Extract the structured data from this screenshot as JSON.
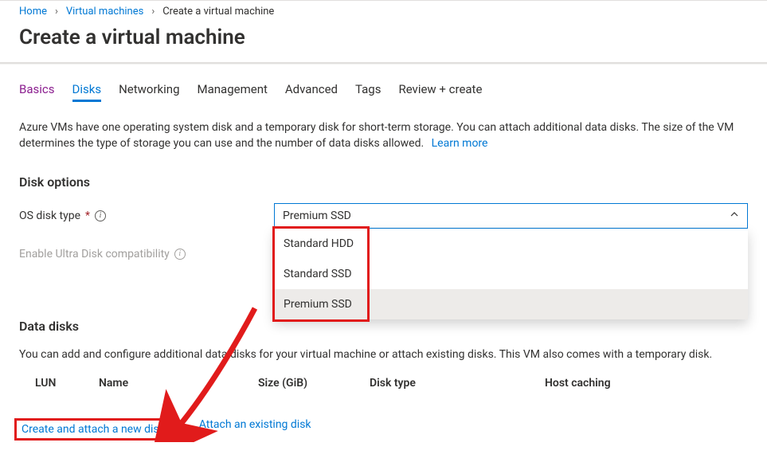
{
  "breadcrumb": {
    "home": "Home",
    "vms": "Virtual machines",
    "current": "Create a virtual machine"
  },
  "page_title": "Create a virtual machine",
  "tabs": {
    "basics": "Basics",
    "disks": "Disks",
    "networking": "Networking",
    "management": "Management",
    "advanced": "Advanced",
    "tags": "Tags",
    "review": "Review + create"
  },
  "helper_text": "Azure VMs have one operating system disk and a temporary disk for short-term storage. You can attach additional data disks. The size of the VM determines the type of storage you can use and the number of data disks allowed.",
  "helper_link": "Learn more",
  "disk_options": {
    "section_title": "Disk options",
    "os_disk_type_label": "OS disk type",
    "selected": "Premium SSD",
    "options": [
      "Standard HDD",
      "Standard SSD",
      "Premium SSD"
    ],
    "ultra_label": "Enable Ultra Disk compatibility"
  },
  "data_disks": {
    "section_title": "Data disks",
    "helper": "You can add and configure additional data disks for your virtual machine or attach existing disks. This VM also comes with a temporary disk.",
    "columns": {
      "lun": "LUN",
      "name": "Name",
      "size": "Size (GiB)",
      "disk_type": "Disk type",
      "host_caching": "Host caching"
    },
    "create_link": "Create and attach a new disk",
    "attach_link": "Attach an existing disk"
  },
  "symbols": {
    "chevron_right": "›",
    "chevron_up": "˄",
    "asterisk": "*",
    "info": "i"
  }
}
